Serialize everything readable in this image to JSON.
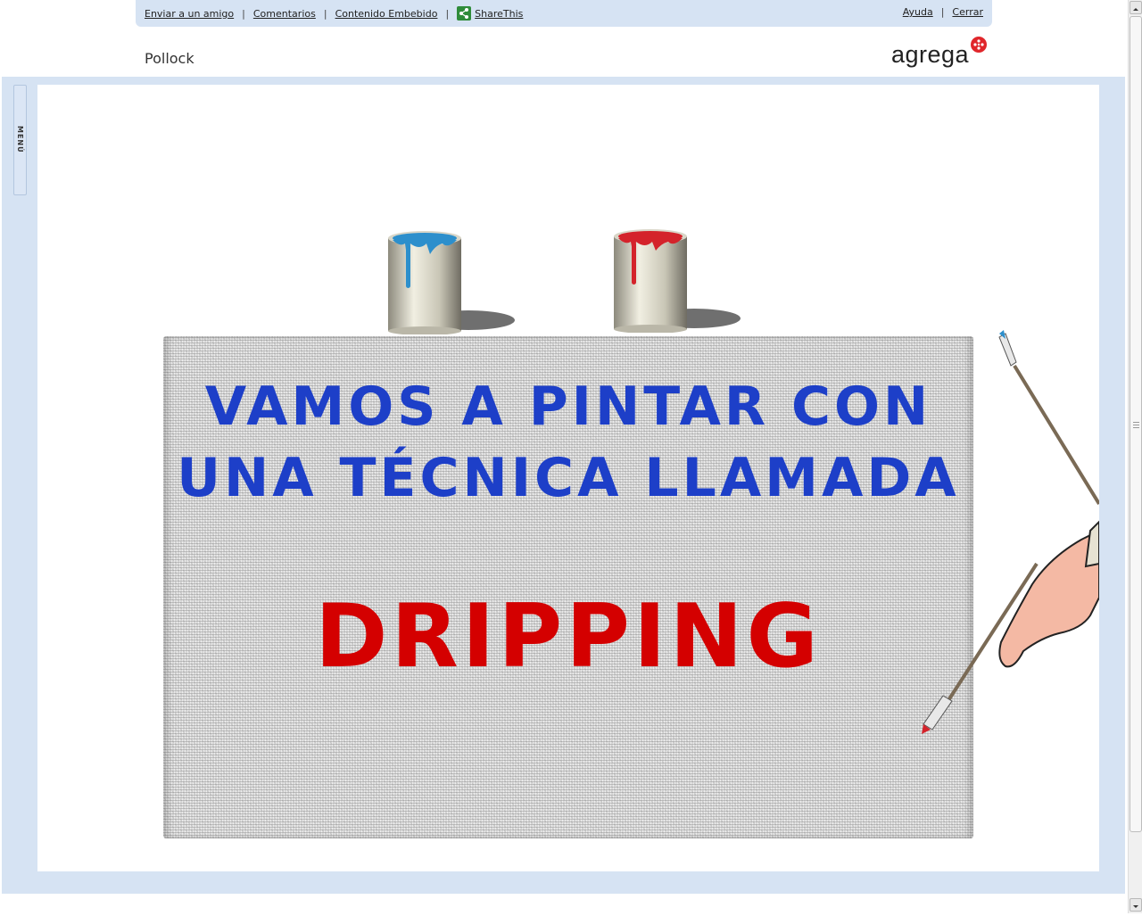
{
  "toolbar": {
    "links": [
      "Enviar a un amigo",
      "Comentarios",
      "Contenido Embebido"
    ],
    "share_label": "ShareThis",
    "help_label": "Ayuda",
    "close_label": "Cerrar"
  },
  "page": {
    "title": "Pollock",
    "logo": "agrega"
  },
  "sidebar": {
    "menu_label": "MENÚ"
  },
  "slide": {
    "line1": "VAMOS A PINTAR CON",
    "line2": "UNA TÉCNICA LLAMADA",
    "highlight": "DRIPPING"
  },
  "colors": {
    "accent_blue": "#1d3fc8",
    "accent_red": "#d40000",
    "frame": "#d6e3f3"
  }
}
